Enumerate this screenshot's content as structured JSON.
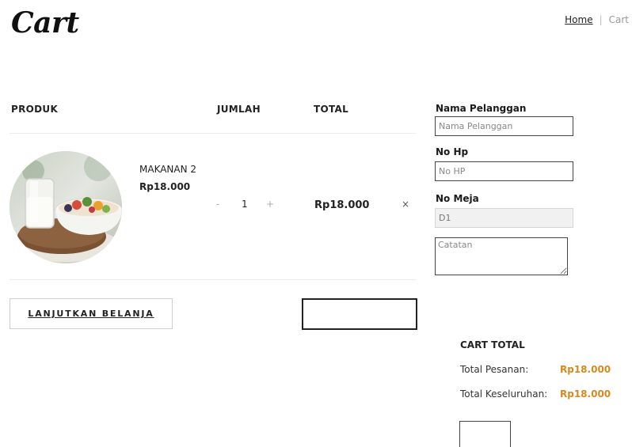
{
  "header": {
    "title": "Cart",
    "breadcrumb": {
      "home": "Home",
      "separator": "|",
      "current": "Cart"
    }
  },
  "table": {
    "headers": {
      "product": "PRODUK",
      "quantity": "JUMLAH",
      "total": "TOTAL"
    },
    "items": [
      {
        "image": "food-bowl-with-milk-photo",
        "name": "MAKANAN 2",
        "price": "Rp18.000",
        "qty_minus": "-",
        "qty": "1",
        "qty_plus": "+",
        "line_total": "Rp18.000",
        "remove": "×"
      }
    ]
  },
  "actions": {
    "continue_shopping": "LANJUTKAN BELANJA",
    "update_cart": ""
  },
  "form": {
    "name_label": "Nama Pelanggan",
    "name_placeholder": "Nama Pelanggan",
    "phone_label": "No Hp",
    "phone_placeholder": "No HP",
    "table_label": "No Meja",
    "table_value": "D1",
    "notes_placeholder": "Catatan"
  },
  "summary": {
    "title": "CART TOTAL",
    "order_total_label": "Total Pesanan:",
    "order_total_value": "Rp18.000",
    "grand_total_label": "Total Keseluruhan:",
    "grand_total_value": "Rp18.000",
    "checkout": ""
  },
  "colors": {
    "accent": "#d48a1e",
    "text": "#1a1a1a",
    "border": "#444444"
  }
}
